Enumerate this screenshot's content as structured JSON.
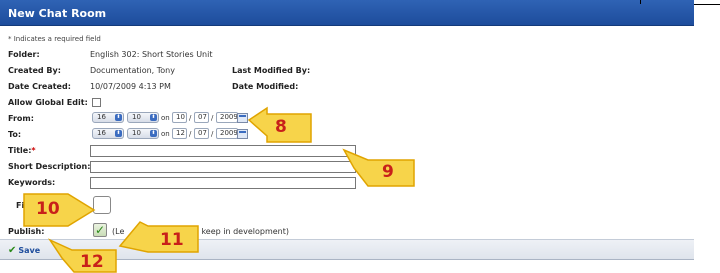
{
  "header": {
    "title": "New Chat Room"
  },
  "form": {
    "required_note": "* Indicates a required field",
    "folder": {
      "label": "Folder:",
      "value": "English 302: Short Stories Unit"
    },
    "created_by": {
      "label": "Created By:",
      "value": "Documentation, Tony"
    },
    "last_modified_by": {
      "label": "Last Modified By:",
      "value": ""
    },
    "date_created": {
      "label": "Date Created:",
      "value": "10/07/2009 4:13 PM"
    },
    "date_modified": {
      "label": "Date Modified:",
      "value": ""
    },
    "allow_global_edit": {
      "label": "Allow Global Edit:",
      "checked": false
    },
    "from": {
      "label": "From:",
      "hour": "16",
      "minute": "10",
      "on": "on",
      "month": "10",
      "day": "07",
      "year": "2009"
    },
    "to": {
      "label": "To:",
      "hour": "16",
      "minute": "10",
      "on": "on",
      "month": "12",
      "day": "07",
      "year": "2009"
    },
    "title": {
      "label": "Title:",
      "required_star": "*",
      "value": ""
    },
    "short_description": {
      "label": "Short Description:",
      "value": ""
    },
    "keywords": {
      "label": "Keywords:",
      "value": ""
    },
    "files": {
      "label": "Files:"
    },
    "publish": {
      "label": "Publish:",
      "checked": true,
      "note_prefix": "(Le",
      "note_suffix": "o keep in development)"
    }
  },
  "footer": {
    "save_label": "Save"
  },
  "callouts": {
    "c8": "8",
    "c9": "9",
    "c10": "10",
    "c11": "11",
    "c12": "12"
  },
  "colors": {
    "header_blue": "#1d4c9c",
    "callout_fill": "#f7d44a",
    "callout_number": "#c8201a"
  }
}
